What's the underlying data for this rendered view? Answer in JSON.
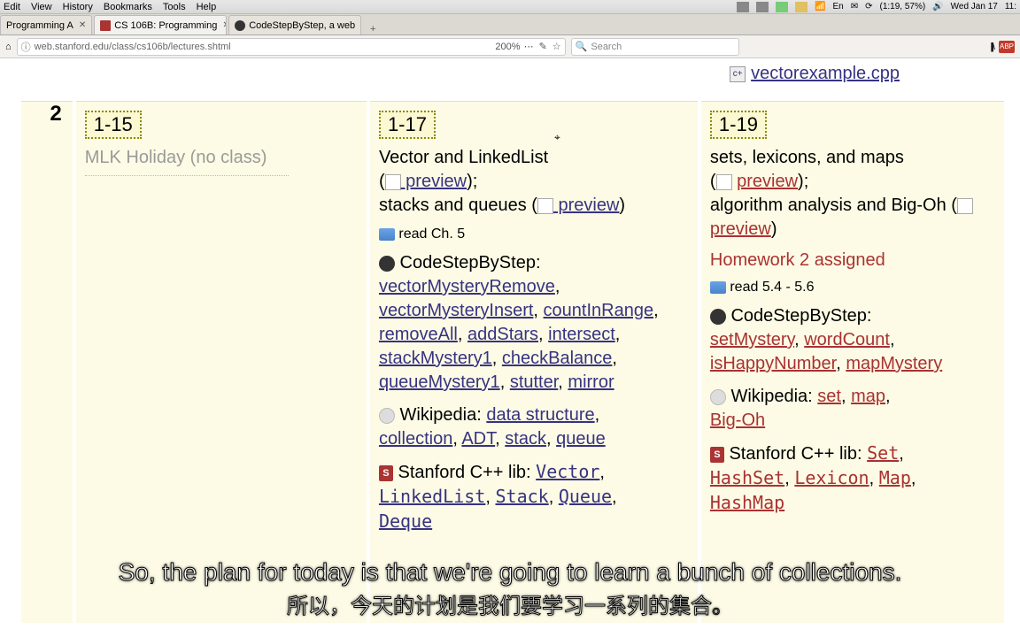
{
  "menubar": {
    "items": [
      "Edit",
      "View",
      "History",
      "Bookmarks",
      "Tools",
      "Help"
    ],
    "clock": "Wed Jan 17",
    "battery": "(1:19, 57%)",
    "lang": "En"
  },
  "tabs": {
    "items": [
      {
        "title": "Programming A",
        "active": false
      },
      {
        "title": "CS 106B: Programming",
        "active": true
      },
      {
        "title": "CodeStepByStep, a web",
        "active": false
      }
    ]
  },
  "toolbar": {
    "url": "web.stanford.edu/class/cs106b/lectures.shtml",
    "zoom": "200%",
    "search_placeholder": "Search"
  },
  "top_file": "vectorexample.cpp",
  "week_number": "2",
  "days": {
    "d1": {
      "date": "1-15",
      "title": "MLK Holiday (no class)"
    },
    "d2": {
      "date": "1-17",
      "topic1": "Vector and LinkedList",
      "preview1": " preview",
      "topic2": "stacks and queues",
      "preview2": " preview",
      "read": "read Ch. 5",
      "csbs_label": "CodeStepByStep:",
      "csbs": [
        "vectorMysteryRemove",
        "vectorMysteryInsert",
        "countInRange",
        "removeAll",
        "addStars",
        "intersect",
        "stackMystery1",
        "checkBalance",
        "queueMystery1",
        "stutter",
        "mirror"
      ],
      "wiki_label": "Wikipedia:",
      "wiki": [
        "data structure",
        "collection",
        "ADT",
        "stack",
        "queue"
      ],
      "lib_label": "Stanford C++ lib:",
      "lib": [
        "Vector",
        "LinkedList",
        "Stack",
        "Queue",
        "Deque"
      ]
    },
    "d3": {
      "date": "1-19",
      "topic1": "sets, lexicons, and maps",
      "preview1": "preview",
      "topic2": "algorithm analysis and Big-Oh",
      "preview2": "preview",
      "hw": "Homework 2 assigned",
      "read": "read 5.4 - 5.6",
      "csbs_label": "CodeStepByStep:",
      "csbs": [
        "setMystery",
        "wordCount",
        "isHappyNumber",
        "mapMystery"
      ],
      "wiki_label": "Wikipedia:",
      "wiki": [
        "set",
        "map",
        "Big-Oh"
      ],
      "lib_label": "Stanford C++ lib:",
      "lib": [
        "Set",
        "HashSet",
        "Lexicon",
        "Map",
        "HashMap"
      ]
    }
  },
  "subtitles": {
    "en": "So, the plan for today is that we're going to learn a bunch of collections.",
    "zh": "所以，今天的计划是我们要学习一系列的集合。"
  }
}
